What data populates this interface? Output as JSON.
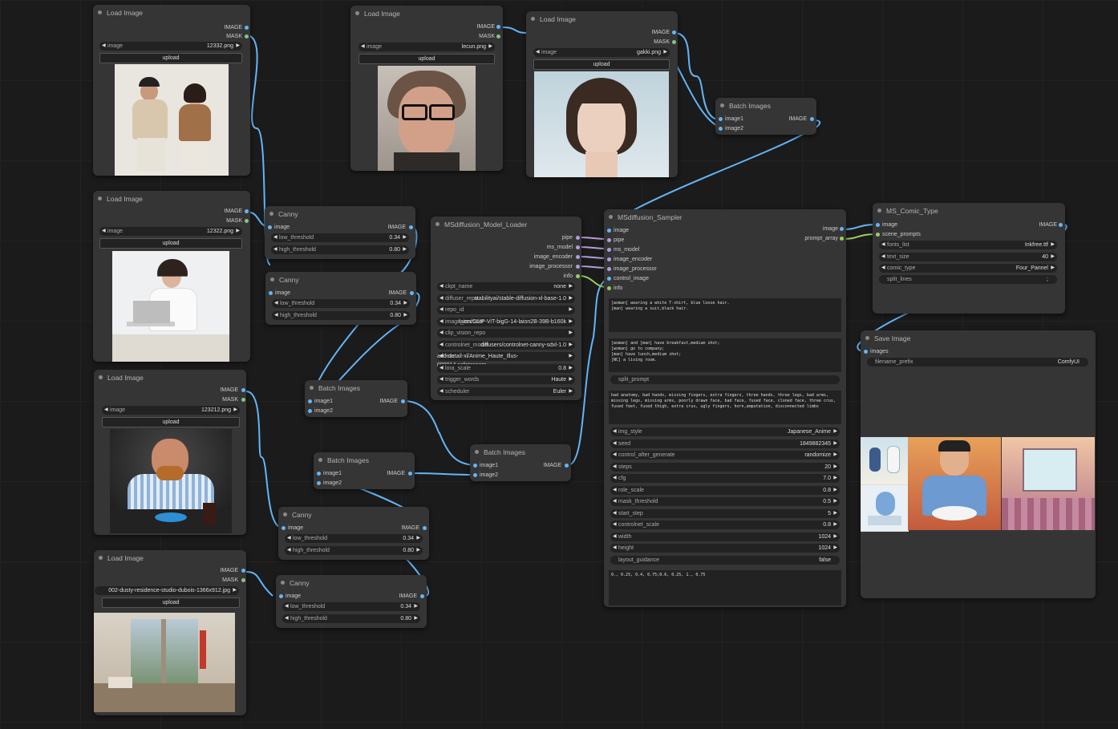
{
  "canvas": {
    "background": "#1b1b1b"
  },
  "colors": {
    "image_wire": "#64b5f6",
    "mask_wire": "#81c784",
    "pipe_wire": "#b39ddb",
    "info_wire": "#9ccc65"
  },
  "load_images": [
    {
      "title": "Load Image",
      "out_image": "IMAGE",
      "out_mask": "MASK",
      "image_label": "image",
      "image_value": "12332.png",
      "upload_label": "upload",
      "photo": "couple-photo"
    },
    {
      "title": "Load Image",
      "out_image": "IMAGE",
      "out_mask": "MASK",
      "image_label": "image",
      "image_value": "lecun.png",
      "upload_label": "upload",
      "photo": "man-glasses-photo"
    },
    {
      "title": "Load Image",
      "out_image": "IMAGE",
      "out_mask": "MASK",
      "image_label": "image",
      "image_value": "gakki.png",
      "upload_label": "upload",
      "photo": "woman-short-hair-photo"
    },
    {
      "title": "Load Image",
      "out_image": "IMAGE",
      "out_mask": "MASK",
      "image_label": "image",
      "image_value": "12322.png",
      "upload_label": "upload",
      "photo": "woman-phone-photo"
    },
    {
      "title": "Load Image",
      "out_image": "IMAGE",
      "out_mask": "MASK",
      "image_label": "image",
      "image_value": "123212.png",
      "upload_label": "upload",
      "photo": "man-burger-photo"
    },
    {
      "title": "Load Image",
      "out_image": "IMAGE",
      "out_mask": "MASK",
      "image_label": "image",
      "image_value": "002-dusty-residence-studio-dubois-1366x912.jpg",
      "upload_label": "upload",
      "photo": "interior-room-photo"
    }
  ],
  "canny_nodes": [
    {
      "title": "Canny",
      "in_image": "image",
      "out_image": "IMAGE",
      "low_label": "low_threshold",
      "low_value": "0.34",
      "high_label": "high_threshold",
      "high_value": "0.80"
    },
    {
      "title": "Canny",
      "in_image": "image",
      "out_image": "IMAGE",
      "low_label": "low_threshold",
      "low_value": "0.34",
      "high_label": "high_threshold",
      "high_value": "0.80"
    },
    {
      "title": "Canny",
      "in_image": "image",
      "out_image": "IMAGE",
      "low_label": "low_threshold",
      "low_value": "0.34",
      "high_label": "high_threshold",
      "high_value": "0.80"
    },
    {
      "title": "Canny",
      "in_image": "image",
      "out_image": "IMAGE",
      "low_label": "low_threshold",
      "low_value": "0.34",
      "high_label": "high_threshold",
      "high_value": "0.80"
    }
  ],
  "batch_nodes": [
    {
      "title": "Batch Images",
      "in1": "image1",
      "in2": "image2",
      "out_image": "IMAGE"
    },
    {
      "title": "Batch Images",
      "in1": "image1",
      "in2": "image2",
      "out_image": "IMAGE"
    },
    {
      "title": "Batch Images",
      "in1": "image1",
      "in2": "image2",
      "out_image": "IMAGE"
    },
    {
      "title": "Batch Images",
      "in1": "image1",
      "in2": "image2",
      "out_image": "IMAGE"
    }
  ],
  "model_loader": {
    "title": "MSdiffusion_Model_Loader",
    "outputs": [
      "pipe",
      "ms_model",
      "image_encoder",
      "image_processor",
      "info"
    ],
    "widgets": [
      {
        "label": "ckpt_name",
        "value": "none"
      },
      {
        "label": "diffuser_repo",
        "value": "stabilityai/stable-diffusion-xl-base-1.0"
      },
      {
        "label": "repo_id",
        "value": ""
      },
      {
        "label": "image_encoder",
        "value": "laion/CLIP-ViT-bigG-14-laion2B-39B-b160k"
      },
      {
        "label": "clip_vision_repo",
        "value": ""
      },
      {
        "label": "controlnet_model",
        "value": "diffusers/controlnet-canny-sdxl-1.0"
      },
      {
        "label": "lora",
        "value": "add-detail-xl/Anime_Haute_Illus-000014.safetensors"
      },
      {
        "label": "lora_scale",
        "value": "0.8"
      },
      {
        "label": "trigger_words",
        "value": "Haute"
      },
      {
        "label": "scheduler",
        "value": "Euler"
      }
    ]
  },
  "sampler": {
    "title": "MSdiffusion_Sampler",
    "inputs": [
      "image",
      "pipe",
      "ms_model",
      "image_encoder",
      "image_processor",
      "control_image",
      "info"
    ],
    "outputs": [
      "image",
      "prompt_array"
    ],
    "character_prompt": "[woman] wearing a white T-shirt, blue loose hair.\n[man] wearing a suit,black hair.",
    "scene_prompt": "[woman] and [man] have breakfast,medium shot;\n[woman] go to company;\n[man] have lunch,medium shot;\n[NC] a living room.",
    "split_prompt": "split_prompt",
    "negative_prompt": "bad anatomy, bad hands, missing fingers, extra fingers, three hands, three legs, bad arms, missing legs, missing arms, poorly drawn face, bad face, fused face, cloned face, three crus, fused feet, fused thigh, extra crus, ugly fingers, horn,amputation, disconnected limbs",
    "widgets": [
      {
        "label": "img_style",
        "value": "Japanese_Anime"
      },
      {
        "label": "seed",
        "value": "1849882345"
      },
      {
        "label": "control_after_generate",
        "value": "randomize"
      },
      {
        "label": "steps",
        "value": "20"
      },
      {
        "label": "cfg",
        "value": "7.0"
      },
      {
        "label": "role_scale",
        "value": "0.8"
      },
      {
        "label": "mask_threshold",
        "value": "0.5"
      },
      {
        "label": "start_step",
        "value": "5"
      },
      {
        "label": "controlnet_scale",
        "value": "0.8"
      },
      {
        "label": "width",
        "value": "1024"
      },
      {
        "label": "height",
        "value": "1024"
      }
    ],
    "layout_label": "layout_guidance",
    "layout_value": "false",
    "guidance_text": "0., 0.25, 0.4, 0.75;0.6, 0.25, 1., 0.75"
  },
  "comic_type": {
    "title": "MS_Comic_Type",
    "inputs": [
      "image",
      "scene_prompts"
    ],
    "out_image": "IMAGE",
    "widgets": [
      {
        "label": "fonts_list",
        "value": "Inkfree.ttf"
      },
      {
        "label": "text_size",
        "value": "40"
      },
      {
        "label": "comic_type",
        "value": "Four_Pannel"
      }
    ],
    "split_label": "split_lines",
    "split_value": ";"
  },
  "save_image": {
    "title": "Save Image",
    "input": "images",
    "prefix_label": "filename_prefix",
    "prefix_value": "ComfyUI",
    "panels": [
      "comic-panel-office-couple",
      "comic-panel-lunch-man",
      "comic-panel-living-room"
    ]
  }
}
